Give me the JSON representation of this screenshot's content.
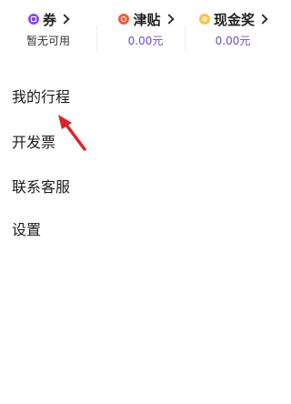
{
  "wallet": {
    "items": [
      {
        "icon": "coupon-icon",
        "label": "券",
        "value": "暂无可用"
      },
      {
        "icon": "allowance-icon",
        "label": "津贴",
        "value": "0.00元"
      },
      {
        "icon": "cash-reward-icon",
        "label": "现金奖",
        "value": "0.00元"
      }
    ]
  },
  "menu": {
    "items": [
      {
        "label": "我的行程"
      },
      {
        "label": "开发票"
      },
      {
        "label": "联系客服"
      },
      {
        "label": "设置"
      }
    ]
  },
  "colors": {
    "coupon": "#8a4de0",
    "allowance": "#e85d3c",
    "cash": "#f3c64c",
    "value": "#6a4fc2",
    "arrow": "#d9242a"
  }
}
